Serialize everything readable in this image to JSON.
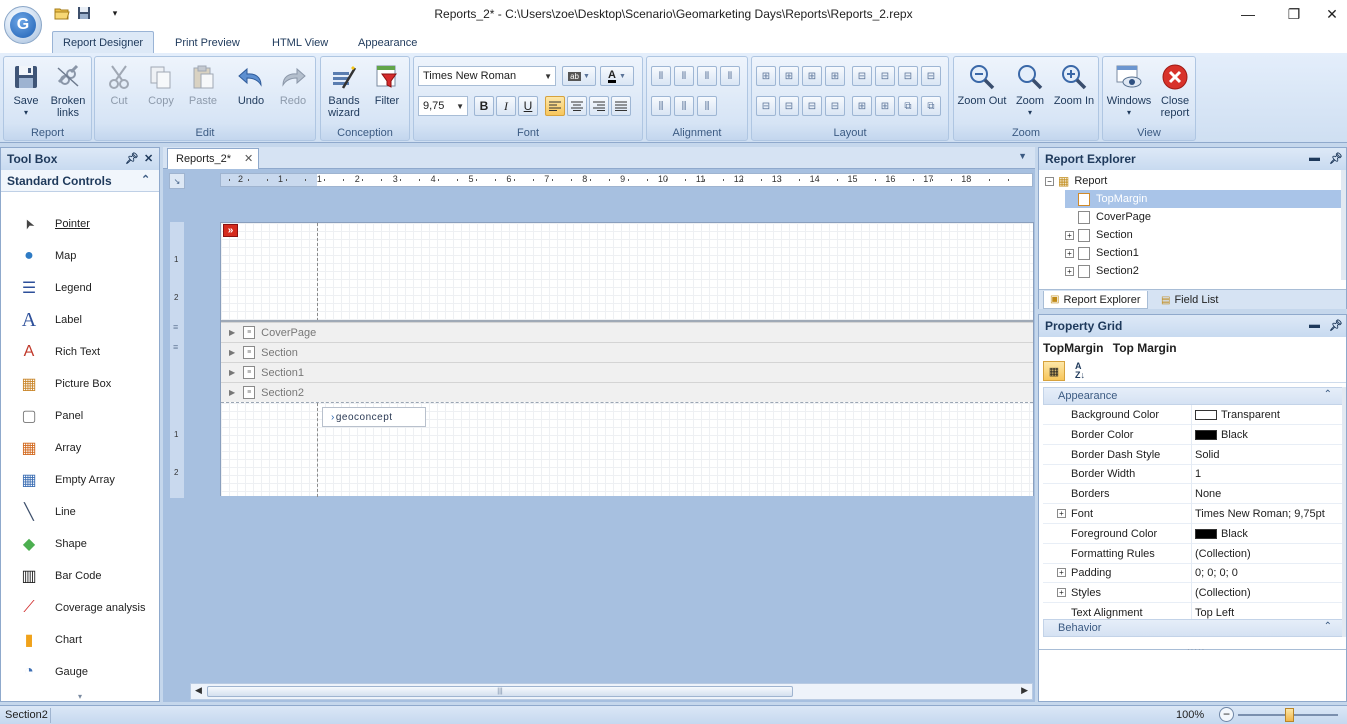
{
  "window": {
    "title": "Reports_2* - C:\\Users\\zoe\\Desktop\\Scenario\\Geomarketing Days\\Reports\\Reports_2.repx"
  },
  "ribbon_tabs": [
    "Report Designer",
    "Print Preview",
    "HTML View",
    "Appearance"
  ],
  "ribbon": {
    "groups": {
      "report": "Report",
      "edit": "Edit",
      "conception": "Conception",
      "font": "Font",
      "alignment": "Alignment",
      "layout": "Layout",
      "zoom": "Zoom",
      "view": "View"
    },
    "buttons": {
      "save": "Save",
      "broken_links": "Broken\nlinks",
      "cut": "Cut",
      "copy": "Copy",
      "paste": "Paste",
      "undo": "Undo",
      "redo": "Redo",
      "bands_wizard": "Bands\nwizard",
      "filter": "Filter",
      "zoom_out": "Zoom Out",
      "zoom": "Zoom",
      "zoom_in": "Zoom In",
      "windows": "Windows",
      "close_report": "Close\nreport"
    },
    "font_name": "Times New Roman",
    "font_size": "9,75",
    "bold": "B",
    "italic": "I",
    "underline": "U"
  },
  "toolbox": {
    "title": "Tool Box",
    "section": "Standard Controls",
    "items": [
      {
        "label": "Pointer",
        "icon": "pointer-icon"
      },
      {
        "label": "Map",
        "icon": "globe-icon"
      },
      {
        "label": "Legend",
        "icon": "legend-icon"
      },
      {
        "label": "Label",
        "icon": "label-icon"
      },
      {
        "label": "Rich Text",
        "icon": "rich-text-icon"
      },
      {
        "label": "Picture Box",
        "icon": "picture-icon"
      },
      {
        "label": "Panel",
        "icon": "panel-icon"
      },
      {
        "label": "Array",
        "icon": "array-icon"
      },
      {
        "label": "Empty Array",
        "icon": "empty-array-icon"
      },
      {
        "label": "Line",
        "icon": "line-icon"
      },
      {
        "label": "Shape",
        "icon": "shape-icon"
      },
      {
        "label": "Bar Code",
        "icon": "barcode-icon"
      },
      {
        "label": "Coverage analysis",
        "icon": "coverage-icon"
      },
      {
        "label": "Chart",
        "icon": "chart-icon"
      },
      {
        "label": "Gauge",
        "icon": "gauge-icon"
      }
    ]
  },
  "document": {
    "tab": "Reports_2*",
    "ruler_labels": [
      "2",
      "1",
      "1",
      "2",
      "3",
      "4",
      "5",
      "6",
      "7",
      "8",
      "9",
      "10",
      "11",
      "12",
      "13",
      "14",
      "15",
      "16",
      "17",
      "18"
    ],
    "vruler_top": [
      "1",
      "2"
    ],
    "vruler_bottom": [
      "1",
      "2"
    ],
    "bands": [
      "CoverPage",
      "Section",
      "Section1",
      "Section2"
    ],
    "logo_text": "geoconcept"
  },
  "report_explorer": {
    "title": "Report Explorer",
    "nodes": [
      {
        "label": "Report",
        "expanded": true
      },
      {
        "label": "TopMargin",
        "selected": true
      },
      {
        "label": "CoverPage"
      },
      {
        "label": "Section"
      },
      {
        "label": "Section1"
      },
      {
        "label": "Section2"
      }
    ],
    "tabs": [
      "Report Explorer",
      "Field List"
    ]
  },
  "property_grid": {
    "title": "Property Grid",
    "selected_name": "TopMargin",
    "selected_type": "Top Margin",
    "categories": {
      "appearance": "Appearance",
      "behavior": "Behavior"
    },
    "rows": [
      {
        "name": "Background Color",
        "value": "Transparent",
        "swatch": "#ffffff"
      },
      {
        "name": "Border Color",
        "value": "Black",
        "swatch": "#000000"
      },
      {
        "name": "Border Dash Style",
        "value": "Solid"
      },
      {
        "name": "Border Width",
        "value": "1"
      },
      {
        "name": "Borders",
        "value": "None"
      },
      {
        "name": "Font",
        "value": "Times New Roman; 9,75pt",
        "expandable": true
      },
      {
        "name": "Foreground Color",
        "value": "Black",
        "swatch": "#000000"
      },
      {
        "name": "Formatting Rules",
        "value": "(Collection)"
      },
      {
        "name": "Padding",
        "value": "0; 0; 0; 0",
        "expandable": true
      },
      {
        "name": "Styles",
        "value": "(Collection)",
        "expandable": true
      },
      {
        "name": "Text Alignment",
        "value": "Top Left"
      }
    ]
  },
  "statusbar": {
    "left": "Section2",
    "zoom": "100%"
  }
}
